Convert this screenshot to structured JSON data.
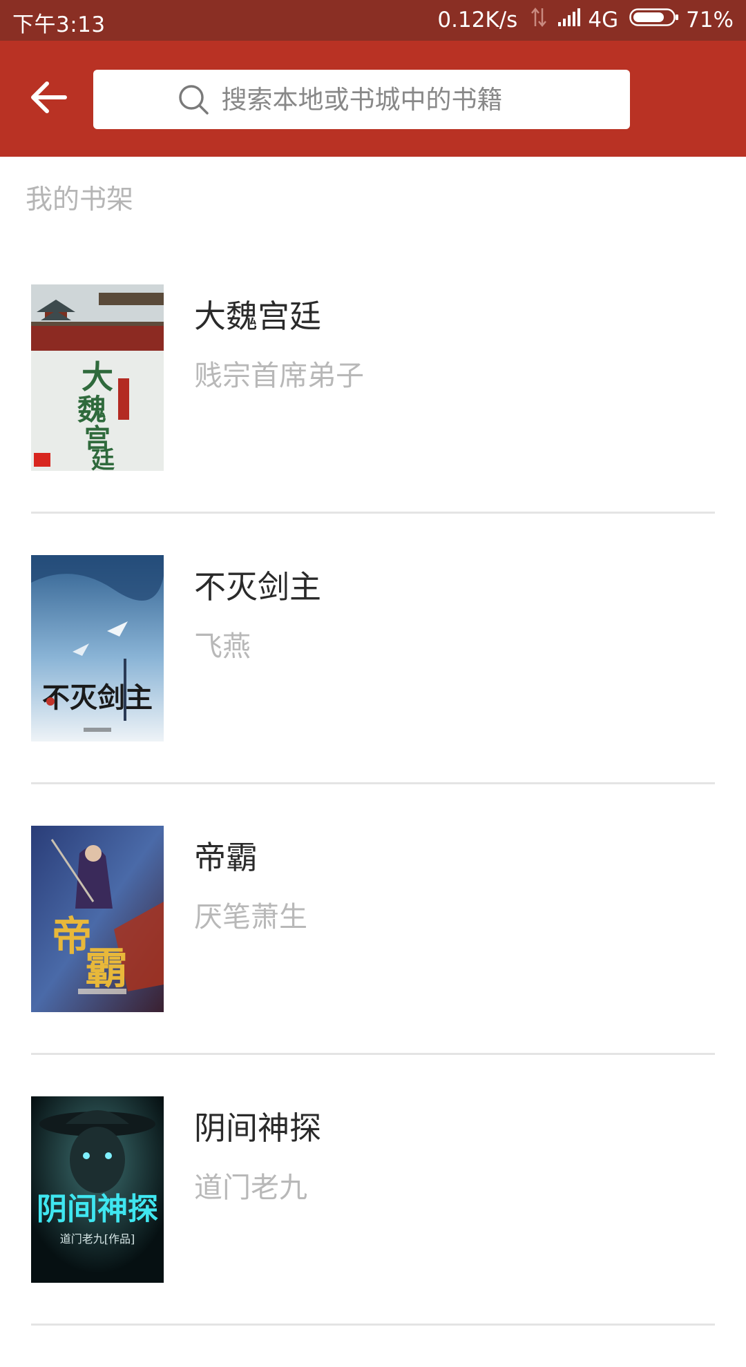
{
  "status_bar": {
    "time": "下午3:13",
    "network_speed": "0.12K/s",
    "network_type": "4G",
    "battery": "71%",
    "icons": [
      "data-arrows-icon",
      "signal-icon",
      "battery-icon"
    ]
  },
  "header": {
    "back_icon": "back-arrow-icon",
    "search_placeholder": "搜索本地或书城中的书籍",
    "search_icon": "search-icon",
    "colors": {
      "status_bar": "#8a2f24",
      "toolbar": "#b93224"
    }
  },
  "shelf": {
    "title": "我的书架",
    "books": [
      {
        "title": "大魏宫廷",
        "author": "贱宗首席弟子"
      },
      {
        "title": "不灭剑主",
        "author": "飞燕"
      },
      {
        "title": "帝霸",
        "author": "厌笔萧生"
      },
      {
        "title": "阴间神探",
        "author": "道门老九"
      }
    ]
  }
}
